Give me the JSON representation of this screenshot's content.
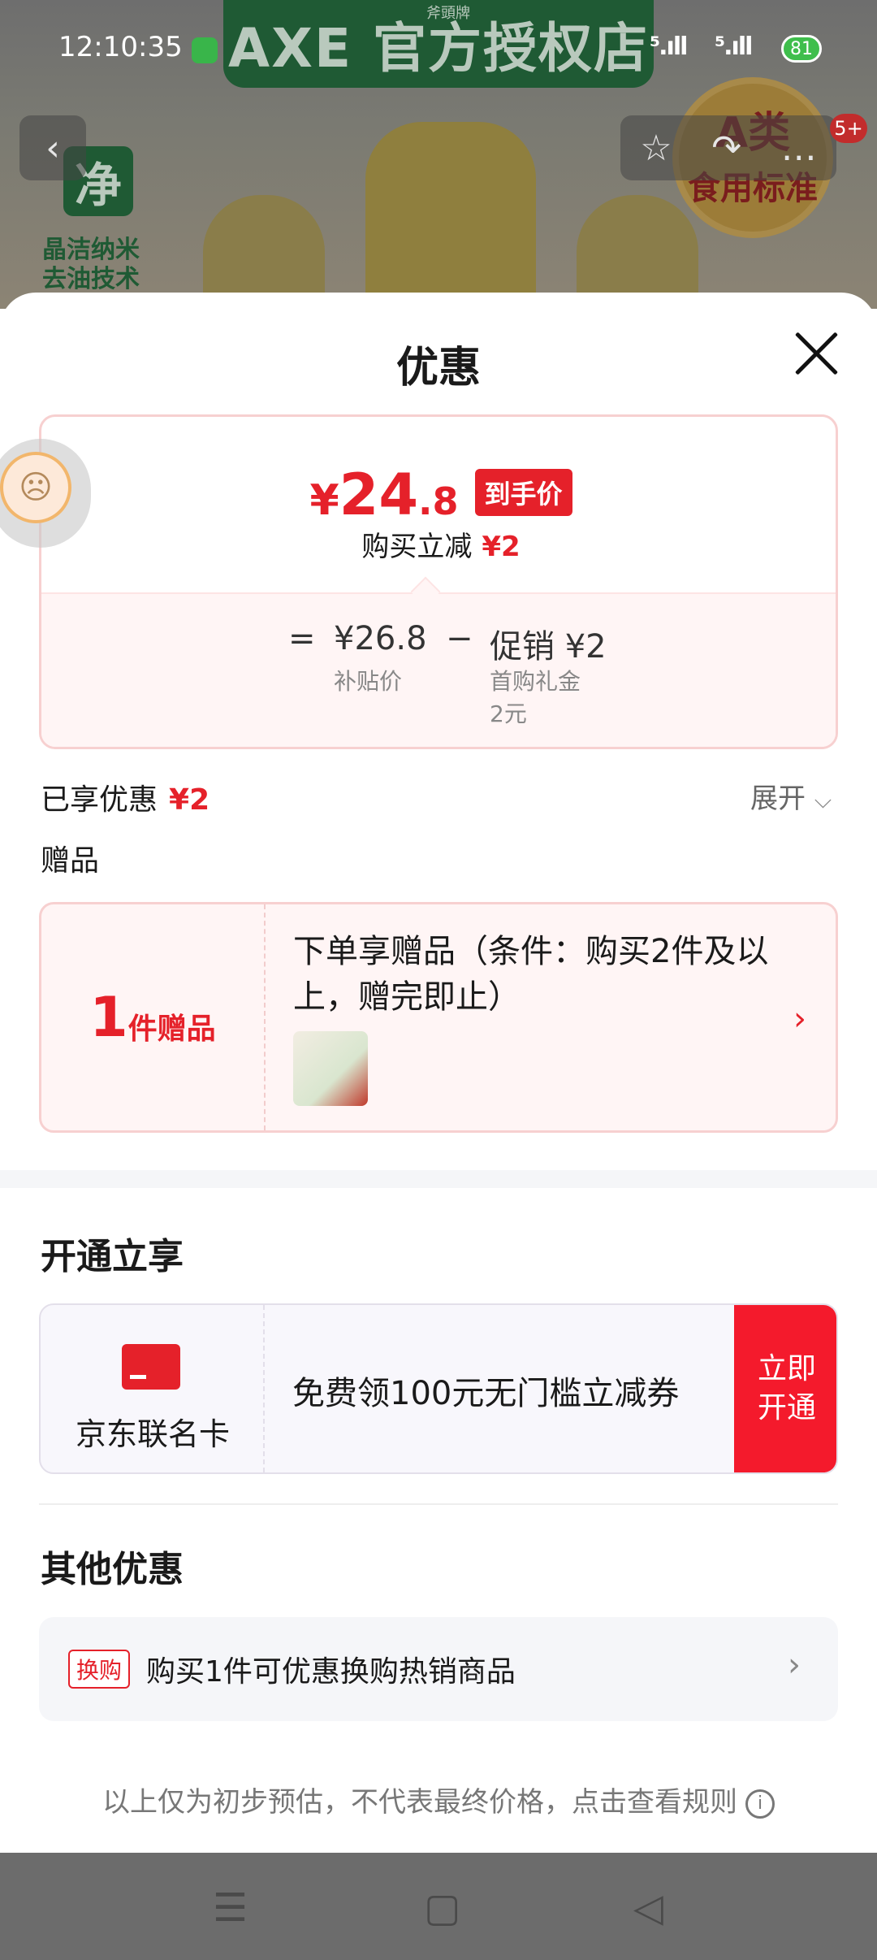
{
  "statusbar": {
    "time": "12:10:35",
    "battery": "81",
    "signal1": "⁵.ıll",
    "signal2": "⁵.ıll"
  },
  "background": {
    "banner_text": "AXE 官方授权店",
    "banner_small": "斧頭牌",
    "jing": "净",
    "nano_line1": "晶洁纳米",
    "nano_line2": "去油技术",
    "medal_line1": "A类",
    "medal_line2": "食用标准",
    "notification_count": "5+"
  },
  "sheet": {
    "title": "优惠",
    "price": {
      "currency": "¥",
      "integer": "24",
      "decimal": ".8",
      "tag": "到手价",
      "subtract_label": "购买立减",
      "subtract_value": "¥2"
    },
    "formula": {
      "equals": "=",
      "subsidy_price": "¥26.8",
      "subsidy_label": "补贴价",
      "minus": "−",
      "promo": "促销 ¥2",
      "promo_detail_1": "首购礼金",
      "promo_detail_2": "2元"
    },
    "enjoyed": {
      "label": "已享优惠",
      "value": "¥2",
      "expand": "展开"
    },
    "gifts": {
      "label": "赠品",
      "count": "1",
      "count_label": "件赠品",
      "desc": "下单享赠品（条件：购买2件及以上，赠完即止）"
    },
    "open_enjoy": {
      "heading": "开通立享",
      "card_name": "京东联名卡",
      "offer": "免费领100元无门槛立减券",
      "button": "立即开通"
    },
    "other": {
      "heading": "其他优惠",
      "tag": "换购",
      "text": "购买1件可优惠换购热销商品"
    },
    "note": "以上仅为初步预估，不代表最终价格，点击查看规则"
  },
  "colors": {
    "accent_red": "#e5212a",
    "brand_green": "#1f5a34"
  }
}
